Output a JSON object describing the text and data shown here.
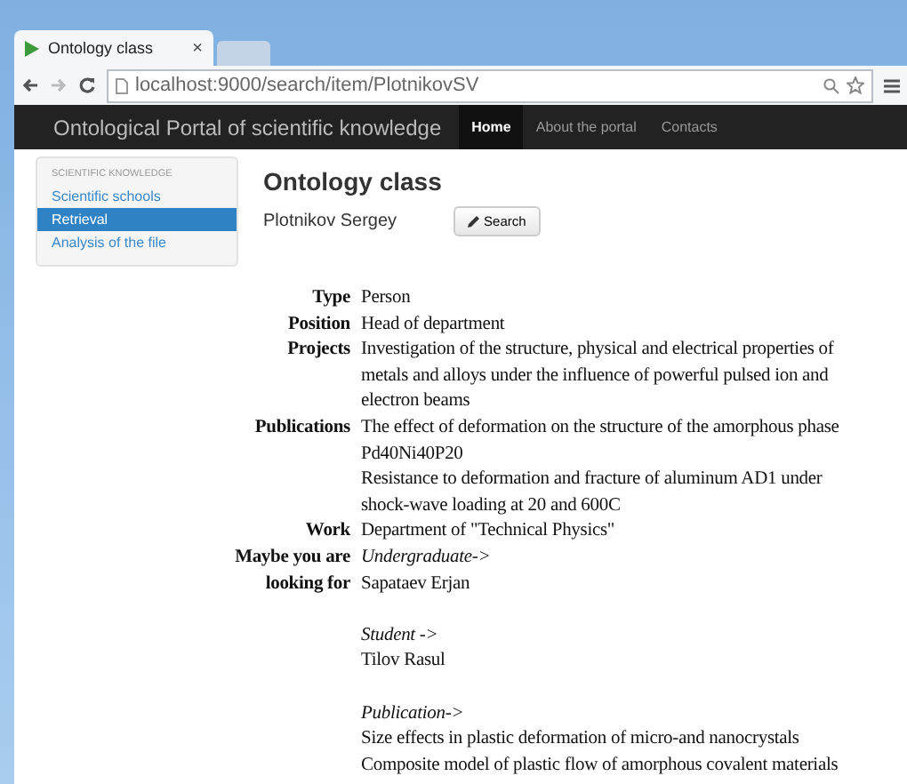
{
  "browser": {
    "tab_title": "Ontology class",
    "tab_close": "×",
    "address": "localhost:9000/search/item/PlotnikovSV"
  },
  "navbar": {
    "brand": "Ontological Portal of scientific knowledge",
    "links": [
      {
        "label": "Home",
        "selected": true
      },
      {
        "label": "About the portal",
        "selected": false
      },
      {
        "label": "Contacts",
        "selected": false
      }
    ]
  },
  "sidebar": {
    "header": "SCIENTIFIC KNOWLEDGE",
    "items": [
      {
        "label": "Scientific schools",
        "selected": false
      },
      {
        "label": "Retrieval",
        "selected": true
      },
      {
        "label": "Analysis of the file",
        "selected": false
      }
    ]
  },
  "page": {
    "title": "Ontology class",
    "person": "Plotnikov Sergey",
    "search_button": "Search"
  },
  "properties": [
    {
      "label": "Type",
      "values": [
        "Person"
      ]
    },
    {
      "label": "Position",
      "values": [
        "Head of department"
      ]
    },
    {
      "label": "Projects",
      "values": [
        "Investigation of the structure, physical and electrical properties of metals and alloys under the influence of powerful pulsed ion and electron beams"
      ]
    },
    {
      "label": "Publications",
      "values": [
        "The effect of deformation on the structure of the amorphous phase Pd40Ni40P20",
        "Resistance to deformation and fracture of aluminum AD1 under shock-wave loading at 20 and 600C"
      ]
    },
    {
      "label": "Work",
      "values": [
        "Department  of \"Technical Physics\""
      ]
    }
  ],
  "suggestions": {
    "label": "Maybe you are looking for",
    "groups": [
      {
        "heading": "Undergraduate->",
        "items": [
          "Sapataev Erjan"
        ]
      },
      {
        "heading": "Student ->",
        "items": [
          "Tilov Rasul"
        ]
      },
      {
        "heading": "Publication->",
        "items": [
          "Size effects in plastic deformation of micro-and nanocrystals",
          "Composite model of plastic flow of amorphous covalent materials"
        ]
      }
    ]
  }
}
